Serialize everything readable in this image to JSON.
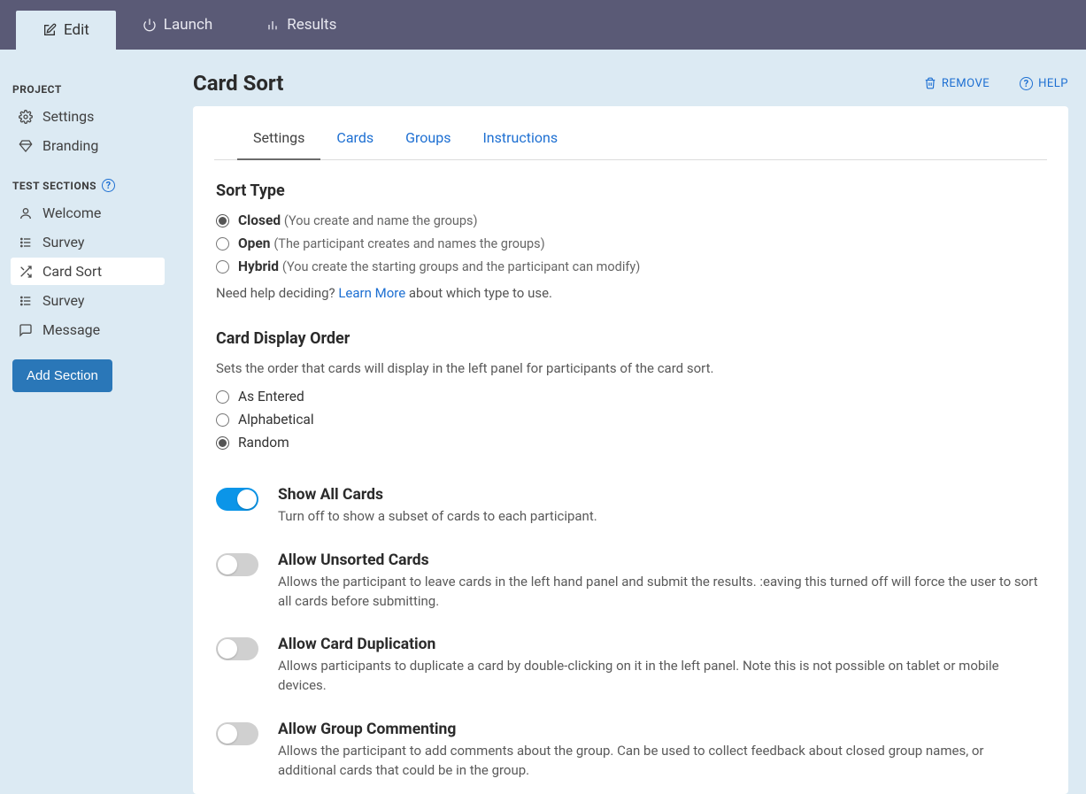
{
  "topnav": {
    "tabs": [
      {
        "label": "Edit",
        "active": true
      },
      {
        "label": "Launch",
        "active": false
      },
      {
        "label": "Results",
        "active": false
      }
    ]
  },
  "sidebar": {
    "projectHeader": "PROJECT",
    "projectItems": [
      {
        "label": "Settings"
      },
      {
        "label": "Branding"
      }
    ],
    "sectionsHeader": "TEST SECTIONS",
    "sectionItems": [
      {
        "label": "Welcome",
        "icon": "user"
      },
      {
        "label": "Survey",
        "icon": "list"
      },
      {
        "label": "Card Sort",
        "icon": "shuffle",
        "active": true
      },
      {
        "label": "Survey",
        "icon": "list"
      },
      {
        "label": "Message",
        "icon": "message"
      }
    ],
    "addSection": "Add Section"
  },
  "page": {
    "title": "Card Sort",
    "removeLabel": "REMOVE",
    "helpLabel": "HELP"
  },
  "innerTabs": [
    {
      "label": "Settings",
      "active": true
    },
    {
      "label": "Cards"
    },
    {
      "label": "Groups"
    },
    {
      "label": "Instructions"
    }
  ],
  "sortType": {
    "title": "Sort Type",
    "options": [
      {
        "label": "Closed",
        "hint": "(You create and name the groups)",
        "checked": true
      },
      {
        "label": "Open",
        "hint": "(The participant creates and names the groups)",
        "checked": false
      },
      {
        "label": "Hybrid",
        "hint": "(You create the starting groups and the participant can modify)",
        "checked": false
      }
    ],
    "helpPrefix": "Need help deciding? ",
    "helpLink": "Learn More",
    "helpSuffix": " about which type to use."
  },
  "displayOrder": {
    "title": "Card Display Order",
    "desc": "Sets the order that cards will display in the left panel for participants of the card sort.",
    "options": [
      {
        "label": "As Entered",
        "checked": false
      },
      {
        "label": "Alphabetical",
        "checked": false
      },
      {
        "label": "Random",
        "checked": true
      }
    ]
  },
  "toggles": [
    {
      "title": "Show All Cards",
      "desc": "Turn off to show a subset of cards to each participant.",
      "on": true
    },
    {
      "title": "Allow Unsorted Cards",
      "desc": "Allows the participant to leave cards in the left hand panel and submit the results. :eaving this turned off will force the user to sort all cards before submitting.",
      "on": false
    },
    {
      "title": "Allow Card Duplication",
      "desc": "Allows participants to duplicate a card by double-clicking on it in the left panel. Note this is not possible on tablet or mobile devices.",
      "on": false
    },
    {
      "title": "Allow Group Commenting",
      "desc": "Allows the participant to add comments about the group. Can be used to collect feedback about closed group names, or additional cards that could be in the group.",
      "on": false
    }
  ]
}
